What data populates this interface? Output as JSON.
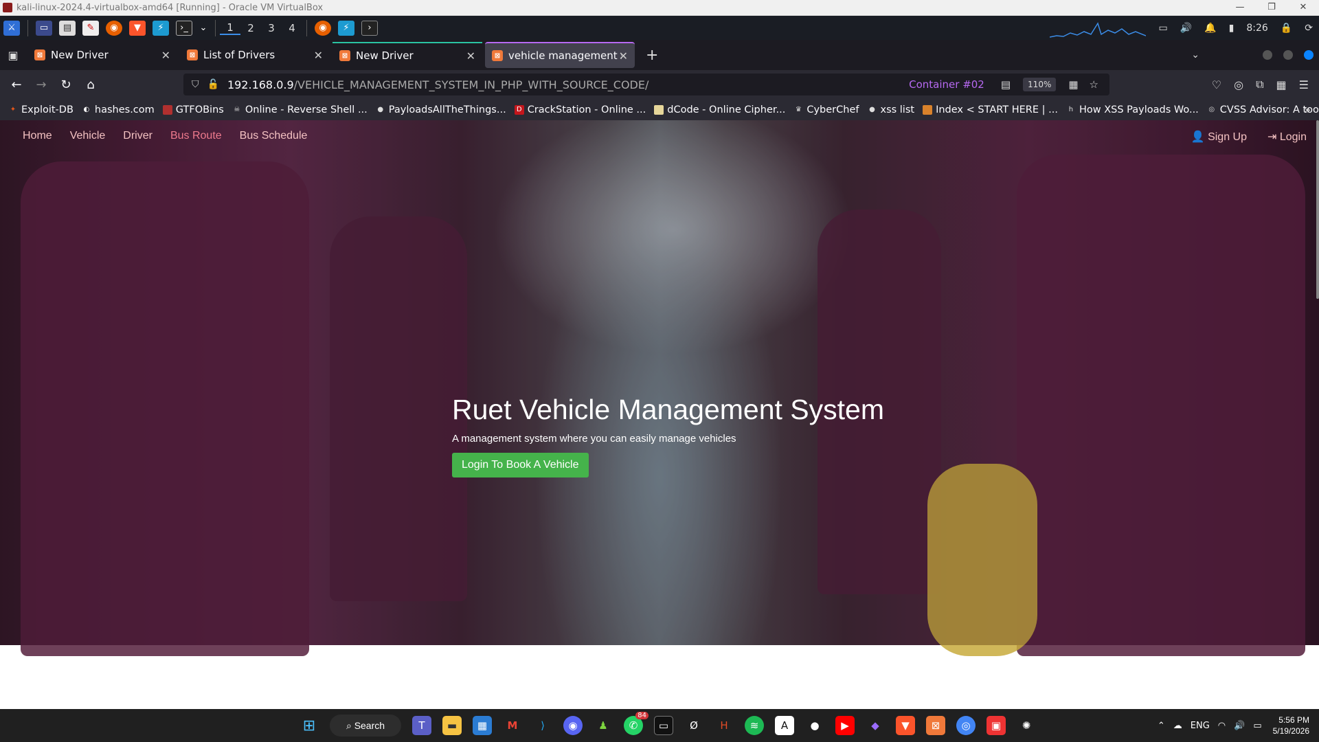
{
  "vbox": {
    "title": "kali-linux-2024.4-virtualbox-amd64 [Running] - Oracle VM VirtualBox",
    "controls": [
      "—",
      "❐",
      "✕"
    ]
  },
  "kali_panel": {
    "workspaces": [
      "1",
      "2",
      "3",
      "4"
    ],
    "time": "8:26"
  },
  "tabs": [
    {
      "title": "New Driver",
      "active": false,
      "container": false
    },
    {
      "title": "List of Drivers",
      "active": false,
      "container": false
    },
    {
      "title": "New Driver",
      "active": false,
      "container": true
    },
    {
      "title": "vehicle management syst",
      "active": true,
      "container": false
    }
  ],
  "urlbar": {
    "host": "192.168.0.9",
    "path": "/VEHICLE_MANAGEMENT_SYSTEM_IN_PHP_WITH_SOURCE_CODE/",
    "container_label": "Container #02",
    "zoom": "110%"
  },
  "bookmarks": [
    {
      "label": "Exploit-DB",
      "icon": "exploitdb-icon",
      "color": "#e8571a"
    },
    {
      "label": "hashes.com",
      "icon": "hashes-icon",
      "color": "#ffffff"
    },
    {
      "label": "GTFOBins",
      "icon": "gtfobins-icon",
      "color": "#b0302f"
    },
    {
      "label": "Online - Reverse Shell ...",
      "icon": "skull-icon",
      "color": "#dddddd"
    },
    {
      "label": "PayloadsAllTheThings...",
      "icon": "github-icon",
      "color": "#dddddd"
    },
    {
      "label": "CrackStation - Online ...",
      "icon": "crackstation-icon",
      "color": "#c4161c"
    },
    {
      "label": "dCode - Online Cipher...",
      "icon": "dcode-icon",
      "color": "#e6d69a"
    },
    {
      "label": "CyberChef",
      "icon": "cyberchef-icon",
      "color": "#dddddd"
    },
    {
      "label": "xss list",
      "icon": "github-icon",
      "color": "#dddddd"
    },
    {
      "label": "Index < START HERE | ...",
      "icon": "index-icon",
      "color": "#d9822b"
    },
    {
      "label": "How XSS Payloads Wo...",
      "icon": "h-icon",
      "color": "#dddddd"
    },
    {
      "label": "CVSS Advisor: A tool t...",
      "icon": "cvss-icon",
      "color": "#dddddd"
    }
  ],
  "site": {
    "nav": [
      {
        "label": "Home"
      },
      {
        "label": "Vehicle"
      },
      {
        "label": "Driver"
      },
      {
        "label": "Bus Route"
      },
      {
        "label": "Bus Schedule"
      }
    ],
    "signup_label": "Sign Up",
    "login_label": "Login",
    "hero_title": "Ruet Vehicle Management System",
    "hero_subtitle": "A management system where you can easily manage vehicles",
    "hero_button": "Login To Book A Vehicle",
    "accent_color": "#45b34b",
    "nav_color": "#f4c2c2"
  },
  "taskbar": {
    "search_label": "Search",
    "whatsapp_badge": "84",
    "lang": "ENG",
    "time": "5:56 PM",
    "date": "5/19/2026"
  }
}
